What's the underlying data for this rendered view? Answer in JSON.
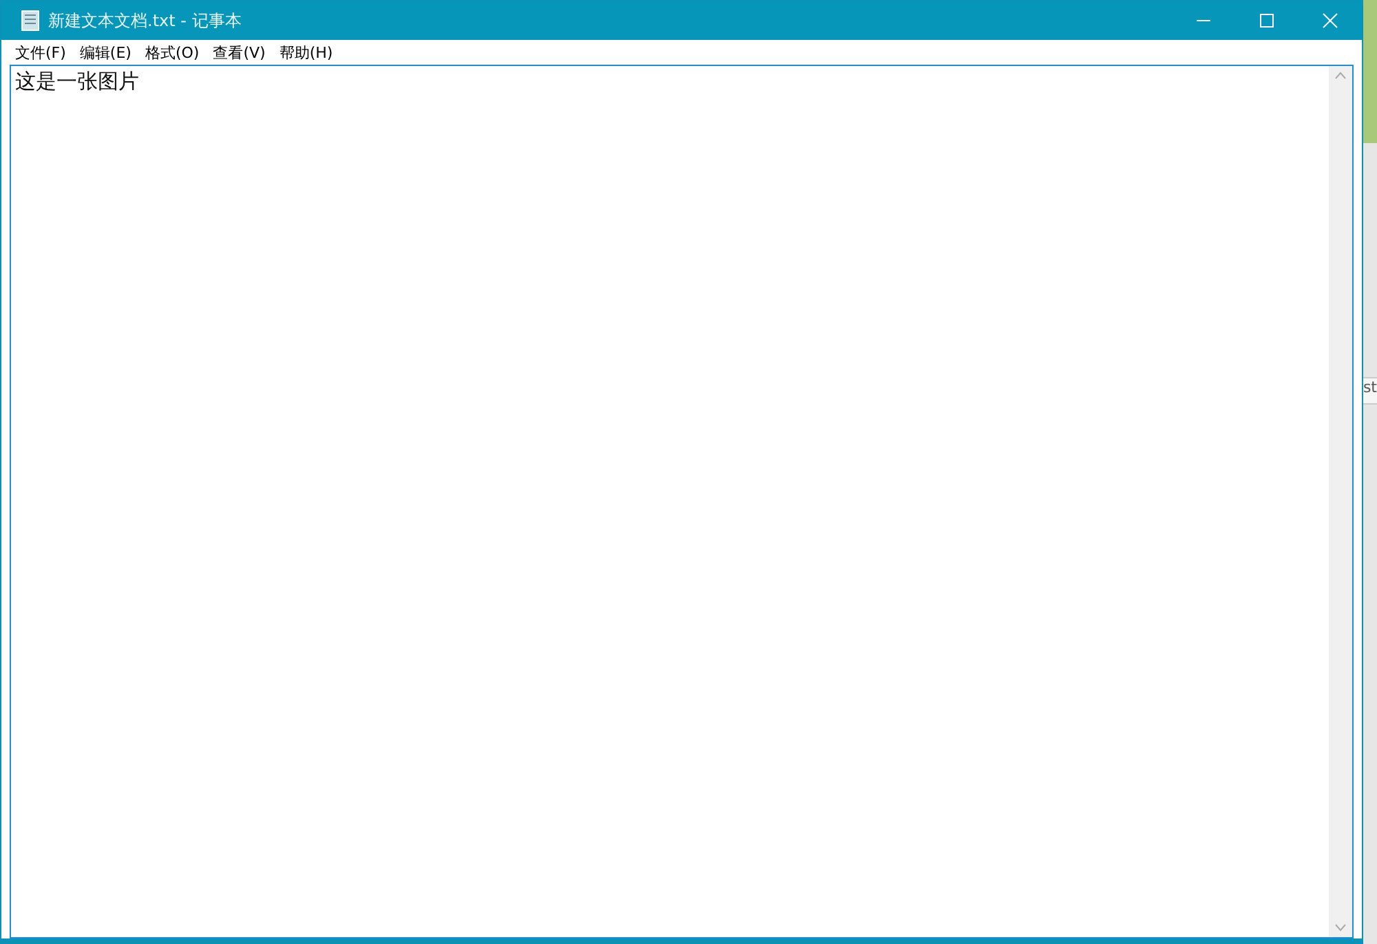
{
  "window": {
    "title": "新建文本文档.txt - 记事本"
  },
  "menu": [
    {
      "label": "文件(F)"
    },
    {
      "label": "编辑(E)"
    },
    {
      "label": "格式(O)"
    },
    {
      "label": "查看(V)"
    },
    {
      "label": "帮助(H)"
    }
  ],
  "editor": {
    "value": "这是一张图片"
  },
  "background_window": {
    "text": "st"
  }
}
